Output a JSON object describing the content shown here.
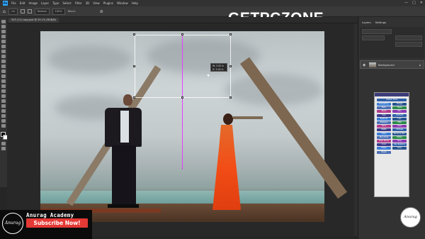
{
  "app": {
    "logo_text": "Ps",
    "menu": [
      "File",
      "Edit",
      "Image",
      "Layer",
      "Type",
      "Select",
      "Filter",
      "3D",
      "View",
      "Plugins",
      "Window",
      "Help"
    ],
    "window_controls": [
      "—",
      "□",
      "✕"
    ]
  },
  "options_bar": {
    "mode": "Normal",
    "opacity": "100%",
    "blend_label": "Blend:"
  },
  "watermark": "GETPCZONE",
  "document": {
    "tab_title": "303 (11) copy.psd @ 29.1% (RGB/8)"
  },
  "canvas": {
    "dimension_tip_w": "W: 3.05 in",
    "dimension_tip_h": "H: 2.00 in"
  },
  "layers_panel": {
    "tabs": [
      "Layers",
      "Settings"
    ],
    "layer_name": "Background",
    "eye_icon": "eye-icon",
    "lock_icon": "lock-icon"
  },
  "plugin_panel": {
    "buttons": [
      "Classic Tools",
      "Frequency",
      "Dodge",
      "Burn",
      "Eyes",
      "Teeth",
      "Skin",
      "Hair",
      "Portrait",
      "Eyeliner",
      "Lips",
      "Sharpen",
      "PNG",
      "Save",
      "Glow",
      "Matte",
      "Vintage",
      "Clean",
      "Remove Blur",
      "Skin Tone",
      "White",
      "Dark Mode",
      "Grey",
      "Color",
      "Sky Replace",
      "White",
      "Grey",
      "Reset"
    ]
  },
  "channel": {
    "logo_text": "Anurag",
    "name": "Anurag Academy",
    "subscribe": "Subscribe Now!",
    "corner_logo_text": "Anurag"
  },
  "colors": {
    "app_bg": "#262626",
    "panel_bg": "#323232",
    "accent": "#31a8ff",
    "subscribe_red": "#e53935",
    "guide": "#e040fb"
  }
}
